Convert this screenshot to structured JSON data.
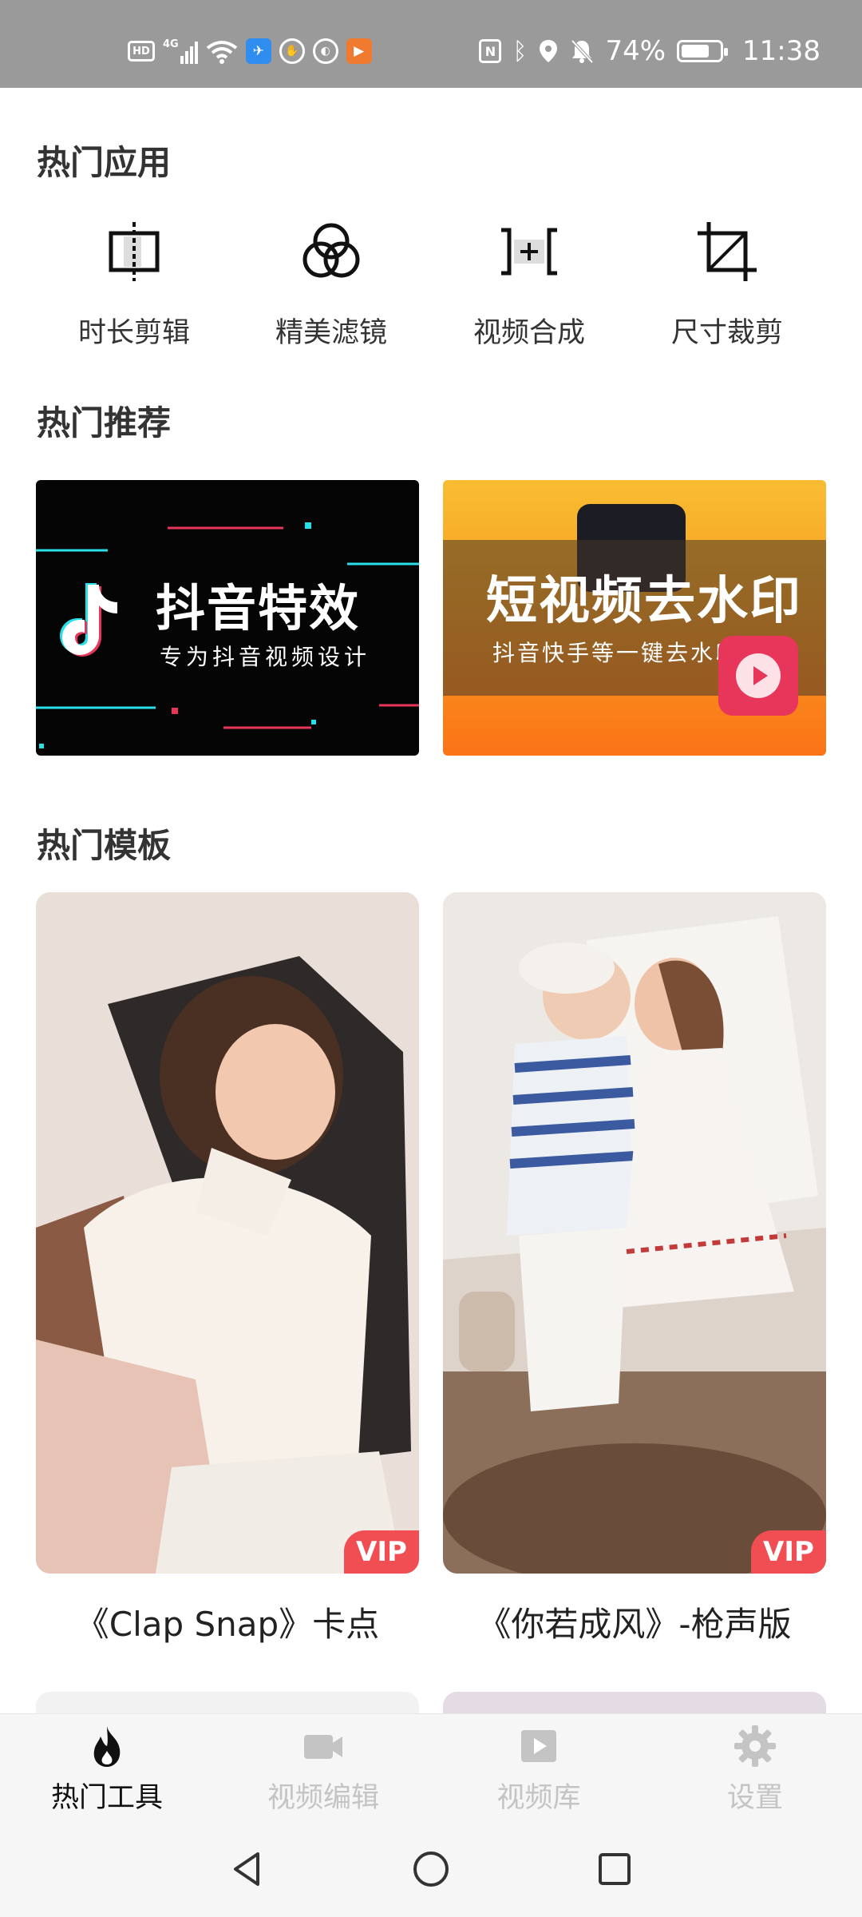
{
  "status_bar": {
    "left_icons": [
      "hd-icon",
      "signal-4g-icon",
      "wifi-icon",
      "app-notification-icon",
      "hand-icon",
      "ball-icon",
      "play-app-icon"
    ],
    "hd_label": "HD",
    "signal_label": "4G",
    "right_icons": [
      "nfc-icon",
      "bluetooth-icon",
      "location-icon",
      "mute-bell-icon"
    ],
    "battery": "74%",
    "battery_level": 0.74,
    "time": "11:38"
  },
  "hot_apps": {
    "title": "热门应用",
    "items": [
      {
        "label": "时长剪辑",
        "icon": "trim-icon"
      },
      {
        "label": "精美滤镜",
        "icon": "filter-icon"
      },
      {
        "label": "视频合成",
        "icon": "merge-icon"
      },
      {
        "label": "尺寸裁剪",
        "icon": "crop-icon"
      }
    ]
  },
  "hot_recommend": {
    "title": "热门推荐",
    "banners": [
      {
        "title": "抖音特效",
        "subtitle": "专为抖音视频设计",
        "icon": "tiktok-icon"
      },
      {
        "title": "短视频去水印",
        "subtitle": "抖音快手等一键去水印",
        "icon": "play-icon"
      }
    ]
  },
  "hot_templates": {
    "title": "热门模板",
    "items": [
      {
        "caption": "《Clap Snap》卡点",
        "badge": "VIP"
      },
      {
        "caption": "《你若成风》-枪声版",
        "badge": "VIP"
      }
    ]
  },
  "bottom_nav": {
    "items": [
      {
        "label": "热门工具",
        "icon": "flame-icon",
        "active": true
      },
      {
        "label": "视频编辑",
        "icon": "video-camera-icon",
        "active": false
      },
      {
        "label": "视频库",
        "icon": "video-library-icon",
        "active": false
      },
      {
        "label": "设置",
        "icon": "gear-icon",
        "active": false
      }
    ]
  },
  "system_nav": [
    "back-icon",
    "home-icon",
    "recents-icon"
  ],
  "colors": {
    "status_bar": "#9a9a9a",
    "vip_badge": "#f04e52",
    "nav_active": "#111111",
    "nav_inactive": "#c4c4c4",
    "banner_orange": "#f99a1f"
  }
}
